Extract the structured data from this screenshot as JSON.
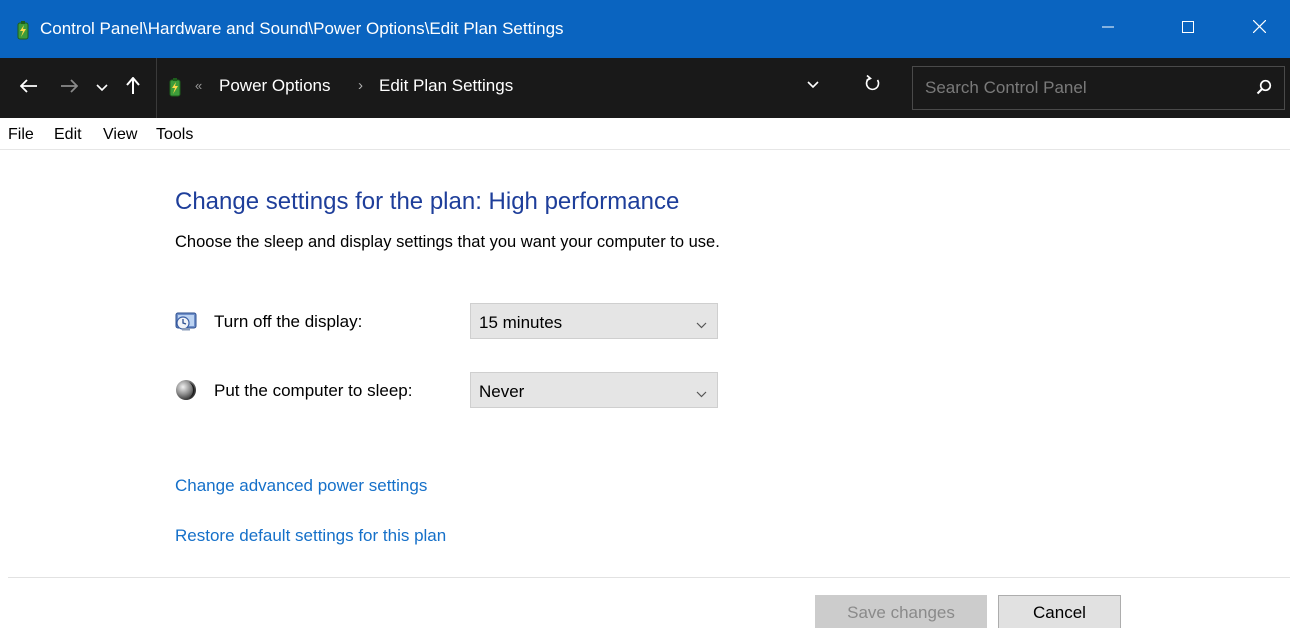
{
  "window": {
    "title": "Control Panel\\Hardware and Sound\\Power Options\\Edit Plan Settings",
    "accent_color": "#0a64c0",
    "app_icon": "power-battery-icon",
    "controls": [
      "minimize-icon",
      "maximize-icon",
      "close-icon"
    ]
  },
  "address_bar": {
    "nav": [
      "back-arrow-icon",
      "forward-arrow-icon",
      "recent-chevron-icon",
      "up-arrow-icon"
    ],
    "location_icon": "power-battery-icon",
    "overflow_marker": "«",
    "breadcrumbs": [
      {
        "label": "Power Options"
      },
      {
        "label": "Edit Plan Settings"
      }
    ],
    "crumb_separator": "›",
    "search_placeholder": "Search Control Panel"
  },
  "menu": {
    "items": [
      {
        "label": "File"
      },
      {
        "label": "Edit"
      },
      {
        "label": "View"
      },
      {
        "label": "Tools"
      }
    ]
  },
  "content": {
    "title": "Change settings for the plan: High performance",
    "description": "Choose the sleep and display settings that you want your computer to use.",
    "settings": [
      {
        "label": "Turn off the display:",
        "value": "15 minutes",
        "icon": "display-clock-icon"
      },
      {
        "label": "Put the computer to sleep:",
        "value": "Never",
        "icon": "moon-sleep-icon"
      }
    ],
    "links": [
      {
        "label": "Change advanced power settings"
      },
      {
        "label": "Restore default settings for this plan"
      }
    ],
    "title_color": "#1e3e9a",
    "link_color": "#1570c9"
  },
  "footer": {
    "save_label": "Save changes",
    "cancel_label": "Cancel"
  }
}
